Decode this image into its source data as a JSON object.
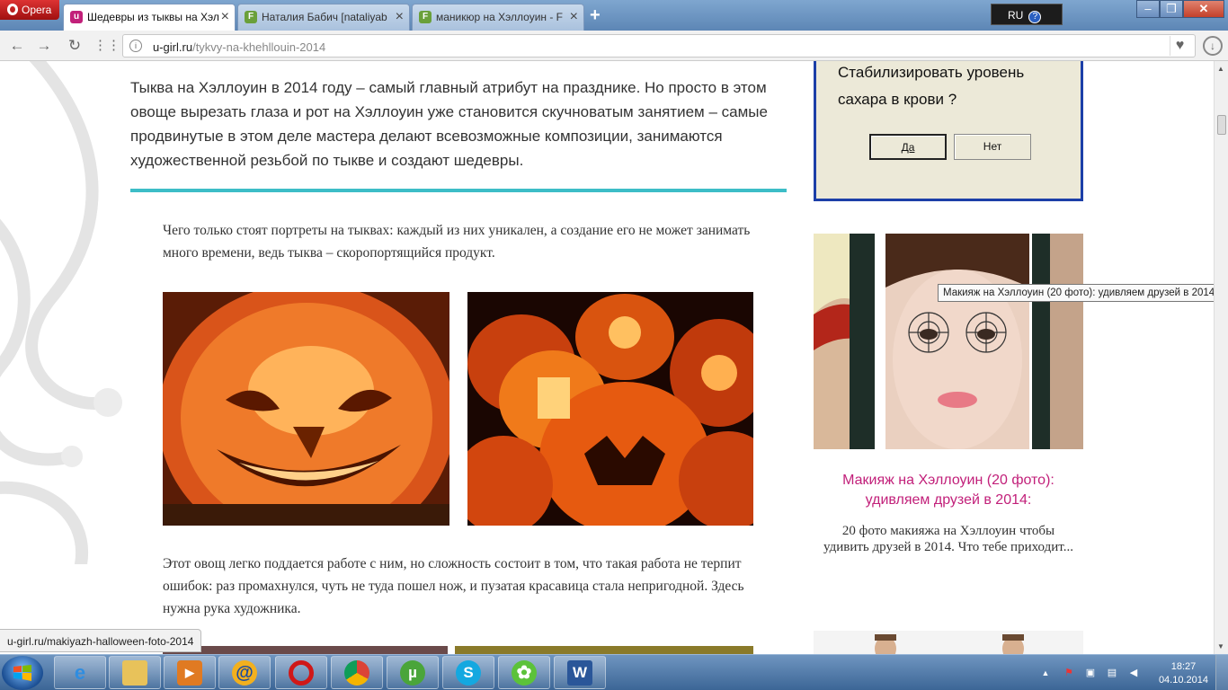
{
  "browser": {
    "menu_label": "Opera",
    "tabs": [
      {
        "title": "Шедевры из тыквы на Хэл",
        "favicon": "u-girl-favicon"
      },
      {
        "title": "Наталия Бабич [nataliyab",
        "favicon": "f-favicon"
      },
      {
        "title": "маникюр на Хэллоуин - F",
        "favicon": "f-favicon"
      }
    ],
    "new_tab": "+",
    "language": "RU",
    "help": "?",
    "url_host": "u-girl.ru",
    "url_path": "/tykvy-na-khehllouin-2014"
  },
  "article": {
    "lead": "Тыква  на Хэллоуин в 2014 году – самый главный атрибут на празднике. Но просто в этом овоще вырезать глаза и рот на Хэллоуин уже становится скучноватым занятием – самые продвинутые в этом деле мастера делают всевозможные композиции, занимаются художественной резьбой по тыкве и создают шедевры.",
    "para1": "Чего только стоят портреты на тыквах: каждый из них уникален, а создание его не может занимать много времени, ведь тыква – скоропортящийся продукт.",
    "para2": "Этот овощ легко поддается работе с ним, но сложность состоит в том, что такая работа не терпит ошибок: раз промахнулся, чуть не туда пошел нож, и пузатая красавица стала непригодной. Здесь нужна рука художника."
  },
  "popup": {
    "question": "Стабилизировать уровень сахара  в крови ?",
    "yes": "Да",
    "no": "Нет"
  },
  "sidebar": {
    "card_title": "Макияж на Хэллоуин (20 фото): удивляем друзей в 2014:",
    "card_desc": "20 фото макияжа на Хэллоуин чтобы удивить друзей в 2014. Что тебе приходит..."
  },
  "tooltip": "Макияж на Хэллоуин (20 фото): удивляем друзей в 2014:",
  "status_url": "u-girl.ru/makiyazh-halloween-foto-2014",
  "taskbar": {
    "apps": [
      "internet-explorer",
      "file-explorer",
      "media-player",
      "mail-agent",
      "opera",
      "chrome",
      "utorrent",
      "skype",
      "icq",
      "word"
    ],
    "time": "18:27",
    "date": "04.10.2014"
  },
  "colors": {
    "accent_rule": "#3dbdc7",
    "link_pink": "#c2207a",
    "popup_border": "#1c3fa8"
  }
}
